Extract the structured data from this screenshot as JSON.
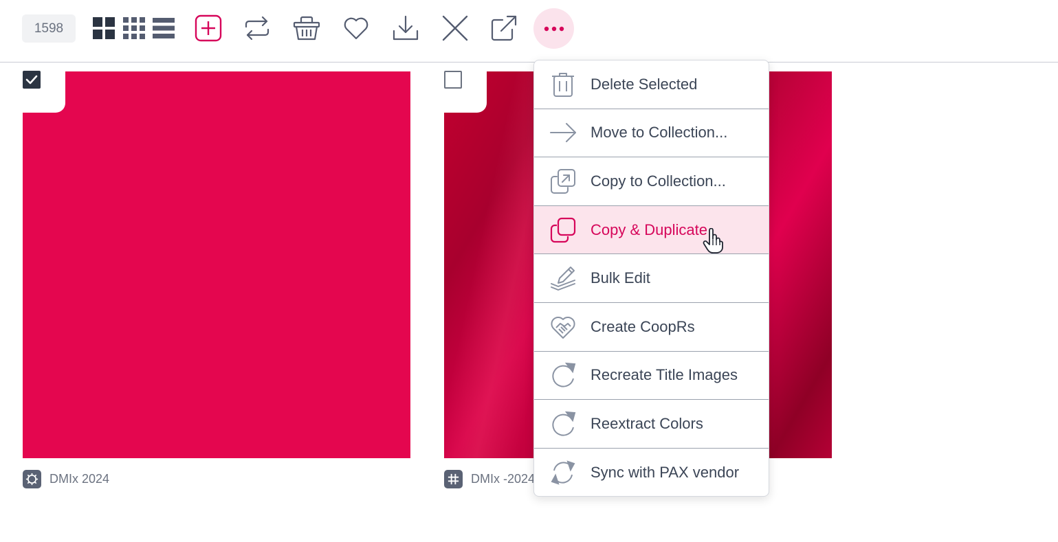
{
  "toolbar": {
    "count": "1598",
    "icons": [
      "grid-large-icon",
      "grid-small-icon",
      "list-icon",
      "add-icon",
      "sync-icon",
      "basket-icon",
      "heart-icon",
      "download-icon",
      "close-icon",
      "external-link-icon",
      "more-icon"
    ]
  },
  "colors": {
    "accent": "#d6065a",
    "accent_bg": "#fce4ec",
    "icon": "#545c70",
    "card1": "#e4064f"
  },
  "cards": [
    {
      "caption": "DMIx 2024",
      "checked": true,
      "caption_icon": "gear-badge-icon"
    },
    {
      "caption": "DMIx -2024",
      "checked": false,
      "caption_icon": "hash-badge-icon"
    }
  ],
  "menu": {
    "items": [
      {
        "label": "Delete Selected",
        "icon": "trash-icon"
      },
      {
        "label": "Move to Collection...",
        "icon": "arrow-right-icon"
      },
      {
        "label": "Copy to Collection...",
        "icon": "copy-to-icon"
      },
      {
        "label": "Copy & Duplicate",
        "icon": "duplicate-icon",
        "active": true
      },
      {
        "label": "Bulk Edit",
        "icon": "pencil-stack-icon"
      },
      {
        "label": "Create CoopRs",
        "icon": "handshake-heart-icon"
      },
      {
        "label": "Recreate Title Images",
        "icon": "refresh-icon"
      },
      {
        "label": "Reextract Colors",
        "icon": "refresh-icon"
      },
      {
        "label": "Sync with PAX vendor",
        "icon": "sync-icon"
      }
    ]
  }
}
